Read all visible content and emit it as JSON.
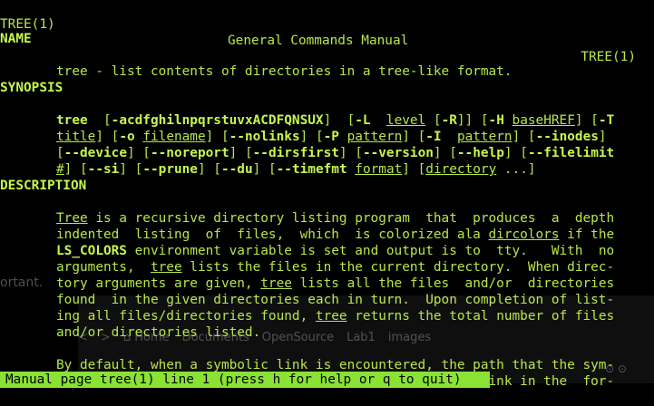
{
  "header": {
    "left": "TREE(1)",
    "center": "General Commands Manual",
    "right": "TREE(1)"
  },
  "sections": {
    "name_heading": "NAME",
    "name_body": "tree - list contents of directories in a tree-like format.",
    "synopsis_heading": "SYNOPSIS",
    "description_heading": "DESCRIPTION"
  },
  "synopsis": {
    "l1_cmd": "tree",
    "l1_a": "  [",
    "l1_opts": "-acdfghilnpqrstuvxACDFQNSUX",
    "l1_b": "]  [",
    "l1_L": "-L",
    "l1_c": "  ",
    "l1_level": "level",
    "l1_d": " [",
    "l1_R": "-R",
    "l1_e": "]] [",
    "l1_H": "-H",
    "l1_f": " ",
    "l1_base": "baseHREF",
    "l1_g": "] [",
    "l1_T": "-T",
    "l2_title": "title",
    "l2_a": "] [",
    "l2_o": "-o",
    "l2_b": " ",
    "l2_filename": "filename",
    "l2_c": "] [",
    "l2_nolinks": "--nolinks",
    "l2_d": "] [",
    "l2_P": "-P",
    "l2_e": " ",
    "l2_pattern1": "pattern",
    "l2_f": "] [",
    "l2_I": "-I",
    "l2_g": "  ",
    "l2_pattern2": "pattern",
    "l2_h": "] [",
    "l2_inodes": "--inodes",
    "l2_i": "]",
    "l3_a": "[",
    "l3_device": "--device",
    "l3_b": "] [",
    "l3_noreport": "--noreport",
    "l3_c": "] [",
    "l3_dirsfirst": "--dirsfirst",
    "l3_d": "] [",
    "l3_version": "--version",
    "l3_e": "] [",
    "l3_help": "--help",
    "l3_f": "] [",
    "l3_filelimit": "--filelimit",
    "l4_hash": "#",
    "l4_a": "] [",
    "l4_si": "--si",
    "l4_b": "] [",
    "l4_prune": "--prune",
    "l4_c": "] [",
    "l4_du": "--du",
    "l4_d": "] [",
    "l4_timefmt": "--timefmt",
    "l4_e": " ",
    "l4_format": "format",
    "l4_f": "] [",
    "l4_directory": "directory",
    "l4_g": " ...]"
  },
  "description": {
    "d1_tree": "Tree",
    "d1_rest": " is a recursive directory listing program  that  produces  a  depth",
    "d2_a": "indented  listing  of  files,  which  is colorized ala ",
    "d2_dircolors": "dircolors",
    "d2_b": " if the",
    "d3_ls": "LS_COLORS",
    "d3_rest": " environment variable is set and output is to  tty.   With  no",
    "d4_a": "arguments,  ",
    "d4_tree": "tree",
    "d4_b": " lists the files in the current directory.  When direc-",
    "d5_a": "tory arguments are given, ",
    "d5_tree": "tree",
    "d5_b": " lists all the files  and/or  directories",
    "d6": "found  in the given directories each in turn.  Upon completion of list-",
    "d7_a": "ing all files/directories found, ",
    "d7_tree": "tree",
    "d7_b": " returns the total number of files",
    "d8": "and/or directories listed.",
    "d9": "By default, when a symbolic link is encountered, the path that the sym-",
    "d10": "bolic link refers to is printed after the name of the link in the  for-"
  },
  "background": {
    "side_text": "ortant.",
    "nav_back": "<",
    "nav_fwd": ">",
    "nav_home": "⌂ Home",
    "nav_documents": "Documents",
    "nav_opensource": "OpenSource",
    "nav_lab1": "Lab1",
    "nav_images": "images",
    "corner_text": "⊙ ⊙"
  },
  "status_bar": {
    "text": "Manual page tree(1) line 1 (press h for help or q to quit)"
  },
  "colors": {
    "foreground": "#b7e64a",
    "background": "#000000",
    "status_bg": "#8ae234"
  }
}
